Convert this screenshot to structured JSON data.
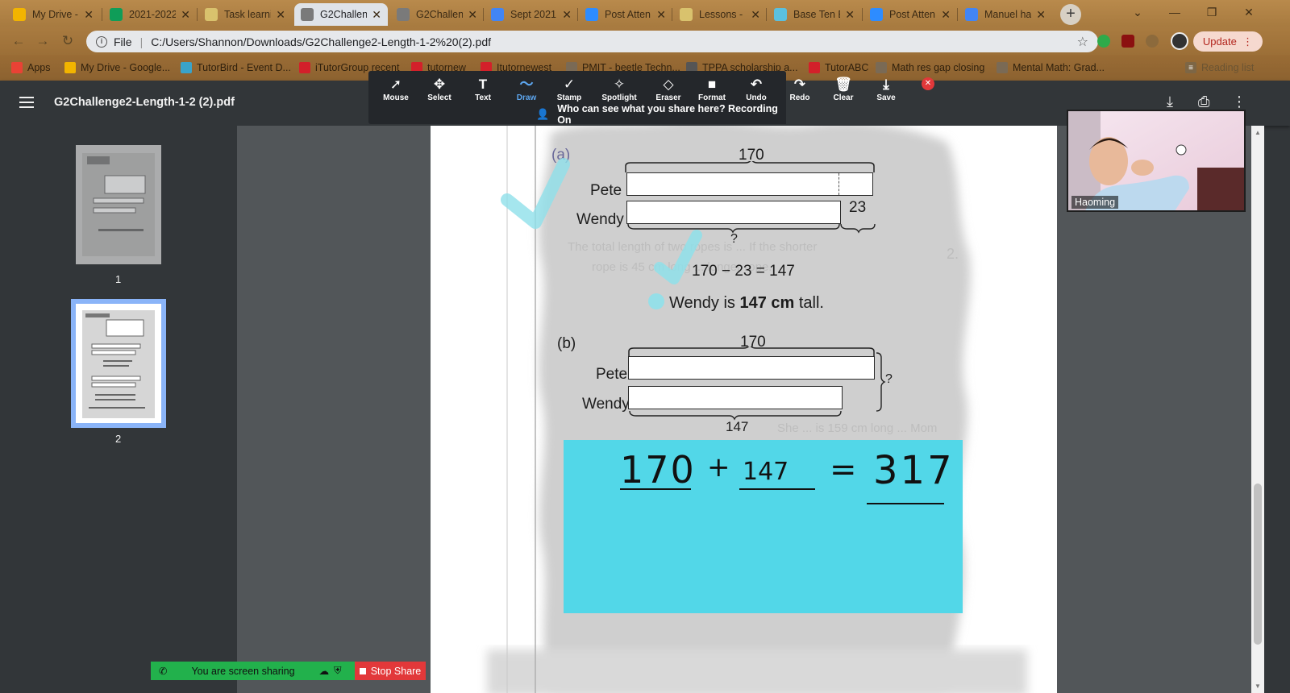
{
  "tabs": [
    {
      "label": "My Drive -",
      "icon": "google-drive-icon",
      "color": "#f2b400"
    },
    {
      "label": "2021-2022",
      "icon": "google-sheets-icon",
      "color": "#0f9d58"
    },
    {
      "label": "Task learni",
      "icon": "classroom-icon",
      "color": "#d9c26d"
    },
    {
      "label": "G2Challen",
      "icon": "web-page-icon",
      "color": "#7a7a7a",
      "active": true
    },
    {
      "label": "G2Challen",
      "icon": "web-page-icon",
      "color": "#7a7a7a"
    },
    {
      "label": "Sept 2021",
      "icon": "google-docs-icon",
      "color": "#4285f4"
    },
    {
      "label": "Post Atten",
      "icon": "zoom-icon",
      "color": "#2d8cff"
    },
    {
      "label": "Lessons -",
      "icon": "classroom-icon",
      "color": "#d9c26d"
    },
    {
      "label": "Base Ten B",
      "icon": "teacher-tool-icon",
      "color": "#5bc0de"
    },
    {
      "label": "Post Atten",
      "icon": "zoom-icon",
      "color": "#2d8cff"
    },
    {
      "label": "Manuel ha",
      "icon": "google-docs-icon",
      "color": "#4285f4"
    }
  ],
  "address": {
    "scheme": "File",
    "url": "C:/Users/Shannon/Downloads/G2Challenge2-Length-1-2%20(2).pdf"
  },
  "update_label": "Update",
  "bookmarks": [
    {
      "label": "Apps",
      "icon": "apps-grid-icon",
      "color": "#e94235"
    },
    {
      "label": "My Drive - Google...",
      "icon": "google-drive-icon",
      "color": "#f2b400"
    },
    {
      "label": "TutorBird - Event D...",
      "icon": "tutorbird-icon",
      "color": "#3aa3c9"
    },
    {
      "label": "iTutorGroup recent",
      "icon": "itutor-icon",
      "color": "#d3202a"
    },
    {
      "label": "tutornew",
      "icon": "itutor-icon",
      "color": "#d3202a"
    },
    {
      "label": "Itutornewest",
      "icon": "itutor-icon",
      "color": "#d3202a"
    },
    {
      "label": "PMIT - beetle Techn...",
      "icon": "globe-icon",
      "color": "#7a6a55"
    },
    {
      "label": "TPPA scholarship a...",
      "icon": "tppa-icon",
      "color": "#555555"
    },
    {
      "label": "TutorABC",
      "icon": "itutor-icon",
      "color": "#d3202a"
    },
    {
      "label": "Math res gap closing",
      "icon": "globe-icon",
      "color": "#7a6a55"
    },
    {
      "label": "Mental Math: Grad...",
      "icon": "globe-icon",
      "color": "#7a6a55"
    }
  ],
  "reading_list": "Reading list",
  "pdf": {
    "title": "G2Challenge2-Length-1-2 (2).pdf",
    "pages": [
      "1",
      "2"
    ]
  },
  "annotation_toolbar": {
    "tools": [
      "Mouse",
      "Select",
      "Text",
      "Draw",
      "Stamp",
      "Spotlight",
      "Eraser",
      "Format",
      "Undo",
      "Redo",
      "Clear",
      "Save"
    ],
    "selected": "Draw",
    "recording_text": "Who can see what you share here? Recording On"
  },
  "worksheet": {
    "a": {
      "part": "(a)",
      "top_total": "170",
      "row1": "Pete",
      "row2": "Wendy",
      "difference": "23",
      "unknown": "?",
      "equation": "170 − 23 = 147",
      "answer_pre": "Wendy is ",
      "answer_bold": "147 cm",
      "answer_post": " tall."
    },
    "b": {
      "part": "(b)",
      "top_total": "170",
      "row1": "Pete",
      "row2": "Wendy",
      "bottom_total": "147",
      "unknown": "?"
    },
    "handwritten": {
      "a": "170",
      "op": "+",
      "b": "147",
      "eq": "=",
      "result": "317"
    },
    "note_color": "#52d7e8",
    "check_color": "#52d7e8"
  },
  "video": {
    "participant": "Haoming"
  },
  "share_bar": {
    "status": "You are screen sharing",
    "stop": "Stop Share"
  }
}
